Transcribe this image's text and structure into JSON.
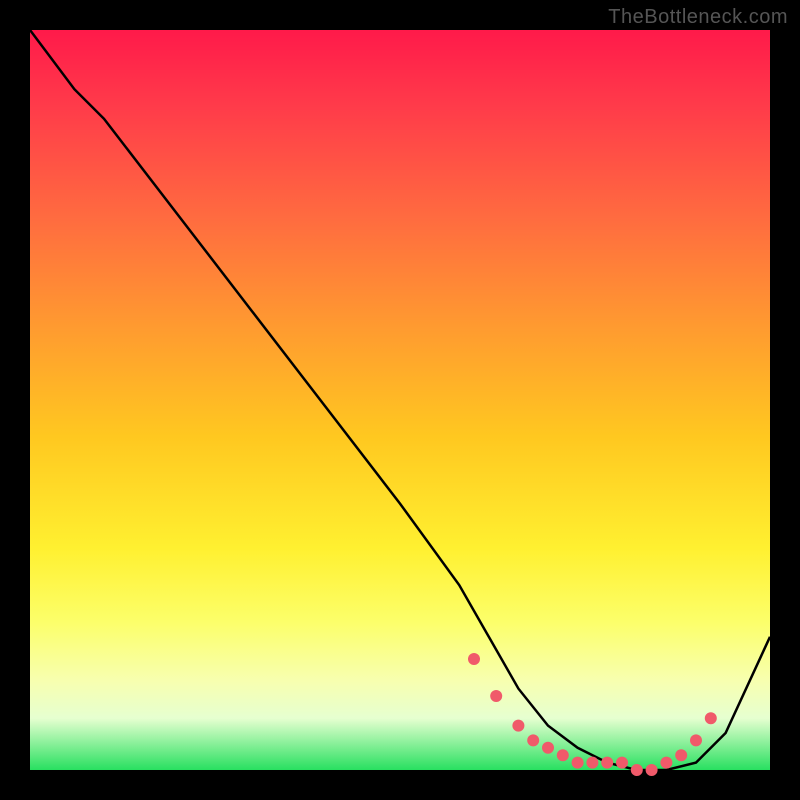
{
  "watermark": "TheBottleneck.com",
  "chart_data": {
    "type": "line",
    "title": "",
    "xlabel": "",
    "ylabel": "",
    "xlim": [
      0,
      100
    ],
    "ylim": [
      0,
      100
    ],
    "series": [
      {
        "name": "bottleneck-curve",
        "x": [
          0,
          6,
          10,
          20,
          30,
          40,
          50,
          58,
          62,
          66,
          70,
          74,
          78,
          82,
          86,
          90,
          94,
          100
        ],
        "y": [
          100,
          92,
          88,
          75,
          62,
          49,
          36,
          25,
          18,
          11,
          6,
          3,
          1,
          0,
          0,
          1,
          5,
          18
        ]
      }
    ],
    "optimal_markers": {
      "name": "optimal-zone-dots",
      "x": [
        60,
        63,
        66,
        68,
        70,
        72,
        74,
        76,
        78,
        80,
        82,
        84,
        86,
        88,
        90,
        92
      ],
      "y": [
        15,
        10,
        6,
        4,
        3,
        2,
        1,
        1,
        1,
        1,
        0,
        0,
        1,
        2,
        4,
        7
      ]
    }
  }
}
